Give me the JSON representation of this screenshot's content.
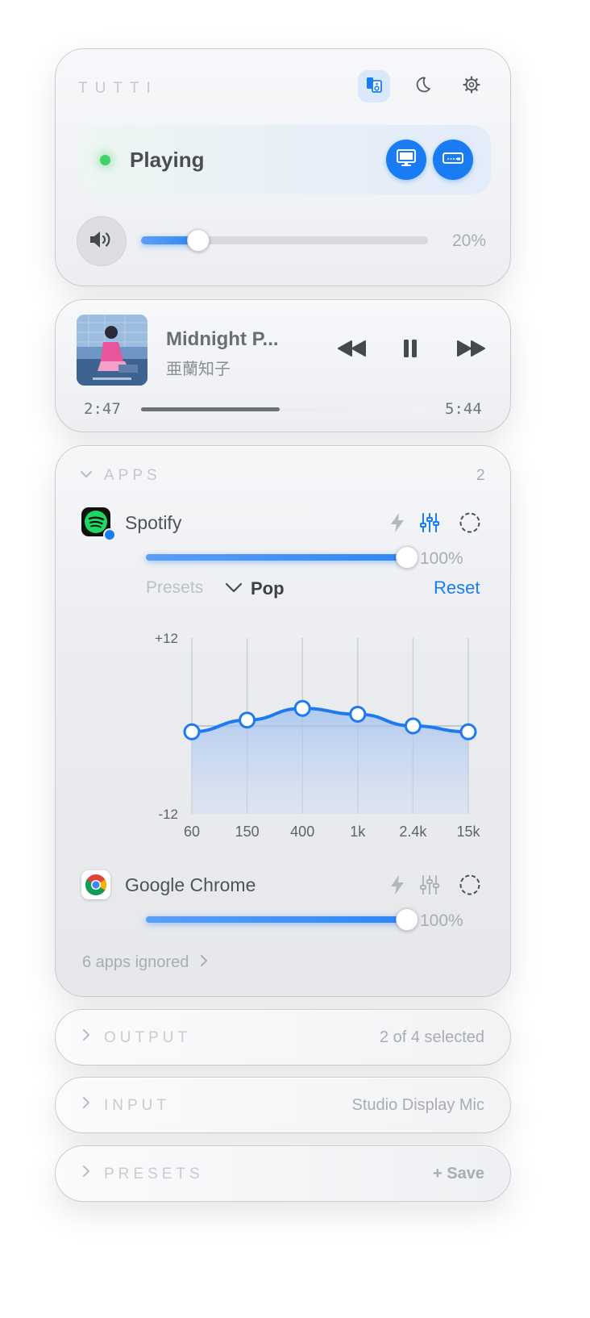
{
  "header": {
    "brand": "TUTTI"
  },
  "status": {
    "label": "Playing"
  },
  "master_volume": {
    "value": 0.2,
    "label": "20%"
  },
  "now_playing": {
    "title": "Midnight P...",
    "artist": "亜蘭知子",
    "elapsed": "2:47",
    "duration": "5:44",
    "progress": 0.485
  },
  "apps": {
    "section_label": "APPS",
    "count": "2",
    "items": [
      {
        "name": "Spotify",
        "volume": 1.0,
        "volume_label": "100%",
        "presets_label": "Presets",
        "preset": "Pop",
        "reset_label": "Reset"
      },
      {
        "name": "Google Chrome",
        "volume": 1.0,
        "volume_label": "100%"
      }
    ],
    "ignored_label": "6 apps ignored"
  },
  "eq": {
    "y_max_label": "+12",
    "y_min_label": "-12",
    "bands": [
      "60",
      "150",
      "400",
      "1k",
      "2.4k",
      "15k"
    ],
    "gains_db": [
      -0.8,
      0.8,
      2.4,
      1.6,
      0,
      -0.8
    ]
  },
  "output": {
    "label": "OUTPUT",
    "summary": "2 of 4 selected"
  },
  "input": {
    "label": "INPUT",
    "summary": "Studio Display Mic"
  },
  "presets": {
    "label": "PRESETS",
    "save_label": "+ Save"
  },
  "colors": {
    "accent": "#1a7cf3",
    "status": "#43d16b"
  },
  "icons": [
    "speakers-icon",
    "moon-icon",
    "gear-icon",
    "display-icon",
    "hdmi-icon",
    "speaker-volume-icon",
    "rewind-icon",
    "pause-icon",
    "forward-icon",
    "bolt-icon",
    "equalizer-icon",
    "dashed-circle-icon",
    "chevron-right-icon",
    "chevron-down-icon"
  ]
}
